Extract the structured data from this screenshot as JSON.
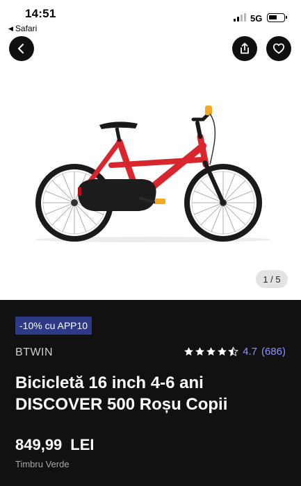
{
  "status_bar": {
    "time": "14:51",
    "back_app_label": "Safari",
    "network": "5G"
  },
  "toolbar": {
    "back_icon": "chevron-left-icon",
    "share_icon": "share-icon",
    "favorite_icon": "heart-icon"
  },
  "gallery": {
    "counter": "1 / 5",
    "product_colors": {
      "frame": "#d7262e",
      "tyre": "#1a1a1a",
      "accent": "#f5a623"
    }
  },
  "product": {
    "promo": "-10% cu APP10",
    "brand": "BTWIN",
    "rating_value": 4.7,
    "rating_label": "4.7",
    "rating_count": "(686)",
    "title": "Bicicletă 16 inch 4-6 ani DISCOVER 500 Roșu Copii",
    "price": "849,99",
    "currency": "LEI",
    "note": "Timbru Verde"
  },
  "colors": {
    "panel_bg": "#111111",
    "promo_bg": "#2f3a87",
    "rating_accent": "#8a95ff"
  }
}
